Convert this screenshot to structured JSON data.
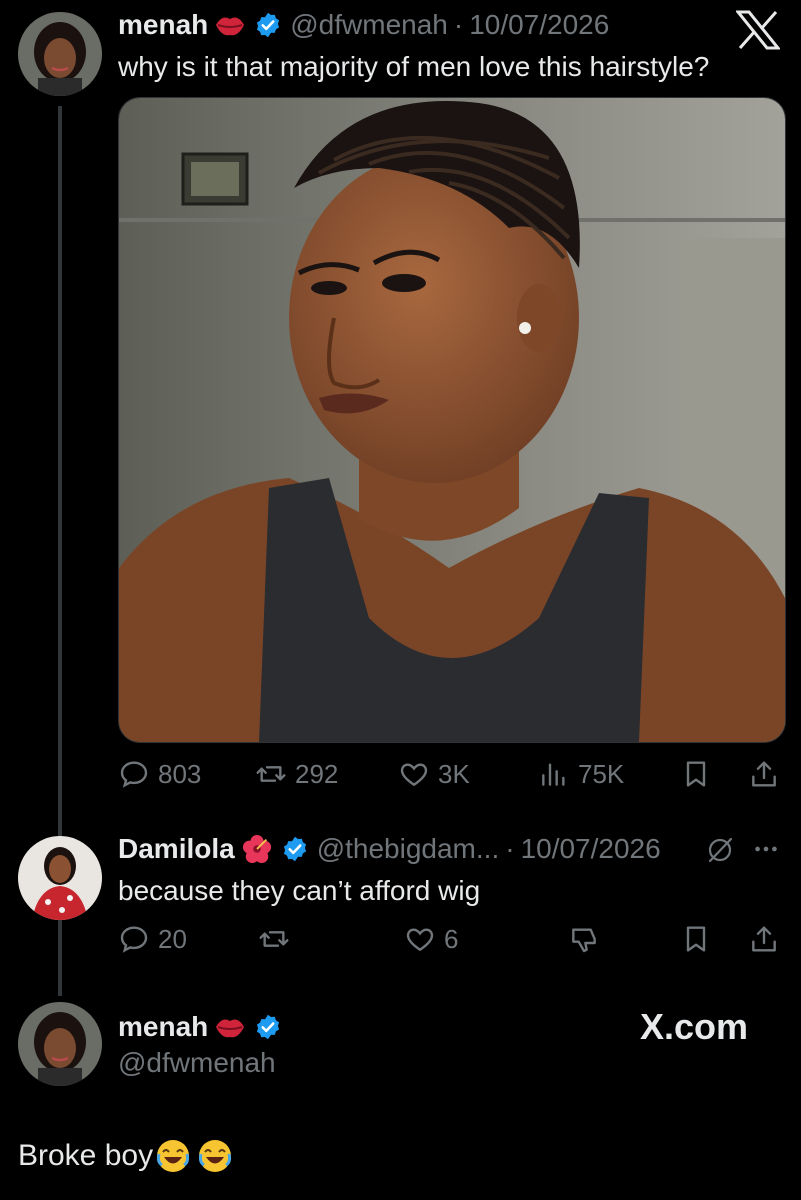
{
  "post": {
    "author_name": "menah",
    "author_handle": "@dfwmenah",
    "separator": "·",
    "date": "10/07/2026",
    "text": "why is it that majority of men love this hairstyle?",
    "image_alt": "woman with cornrows",
    "stats": {
      "replies": "803",
      "reposts": "292",
      "likes": "3K",
      "views": "75K"
    }
  },
  "reply1": {
    "author_name": "Damilola",
    "author_handle": "@thebigdam...",
    "separator": "·",
    "date": "10/07/2026",
    "text": "because they can’t afford wig",
    "stats": {
      "replies": "20",
      "likes": "6"
    }
  },
  "reply2": {
    "author_name": "menah",
    "author_handle": "@dfwmenah",
    "text": "Broke boy"
  },
  "brand": {
    "site": "X.com"
  },
  "colors": {
    "background": "#000000",
    "text": "#e7e9ea",
    "muted": "#71767b",
    "verified": "#1d9bf0",
    "thread_line": "#333639"
  },
  "icons": [
    "x-logo-icon",
    "verified-badge-icon",
    "lips-emoji-icon",
    "hibiscus-emoji-icon",
    "reply-icon",
    "repost-icon",
    "like-icon",
    "views-icon",
    "bookmark-icon",
    "share-icon",
    "grok-icon",
    "more-icon",
    "downvote-icon",
    "laughing-emoji-icon"
  ]
}
